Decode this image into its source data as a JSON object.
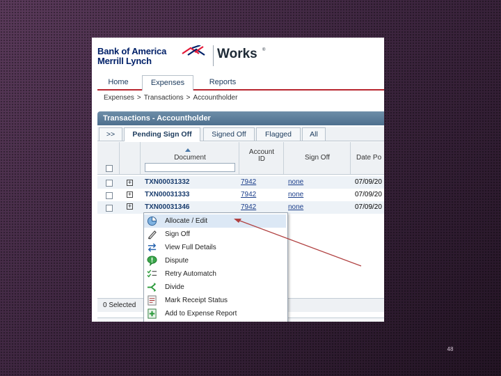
{
  "brand": {
    "line1": "Bank of America",
    "line2": "Merrill Lynch",
    "product": "Works",
    "reg": "®"
  },
  "nav": {
    "tabs": [
      "Home",
      "Expenses",
      "Reports"
    ],
    "active": "Expenses"
  },
  "breadcrumb": [
    "Expenses",
    ">",
    "Transactions",
    ">",
    "Accountholder"
  ],
  "panel": {
    "title": "Transactions - Accountholder"
  },
  "subtabs": [
    ">>",
    "Pending Sign Off",
    "Signed Off",
    "Flagged",
    "All"
  ],
  "table": {
    "headers": {
      "document": "Document",
      "account_id_1": "Account",
      "account_id_2": "ID",
      "sign_off": "Sign Off",
      "date": "Date Po"
    },
    "rows": [
      {
        "document": "TXN00031332",
        "account": "7942",
        "sign_off": "none",
        "date": "07/09/20"
      },
      {
        "document": "TXN00031333",
        "account": "7942",
        "sign_off": "none",
        "date": "07/09/20"
      },
      {
        "document": "TXN00031346",
        "account": "7942",
        "sign_off": "none",
        "date": "07/09/20"
      }
    ]
  },
  "footer": {
    "selected": "0 Selected"
  },
  "context_menu": {
    "items": [
      {
        "label": "Allocate / Edit",
        "icon": "pie-chart-icon"
      },
      {
        "label": "Sign Off",
        "icon": "pen-icon"
      },
      {
        "label": "View Full Details",
        "icon": "arrows-icon"
      },
      {
        "label": "Dispute",
        "icon": "alert-bubble-icon"
      },
      {
        "label": "Retry Automatch",
        "icon": "checklist-icon"
      },
      {
        "label": "Divide",
        "icon": "split-icon"
      },
      {
        "label": "Mark Receipt Status",
        "icon": "receipt-icon"
      },
      {
        "label": "Add to Expense Report",
        "icon": "add-report-icon"
      }
    ]
  },
  "slide": {
    "number": "48"
  },
  "colors": {
    "brand_blue": "#012169",
    "brand_red": "#e31837",
    "accent_red": "#b8252f",
    "annotation": "#b04040"
  }
}
